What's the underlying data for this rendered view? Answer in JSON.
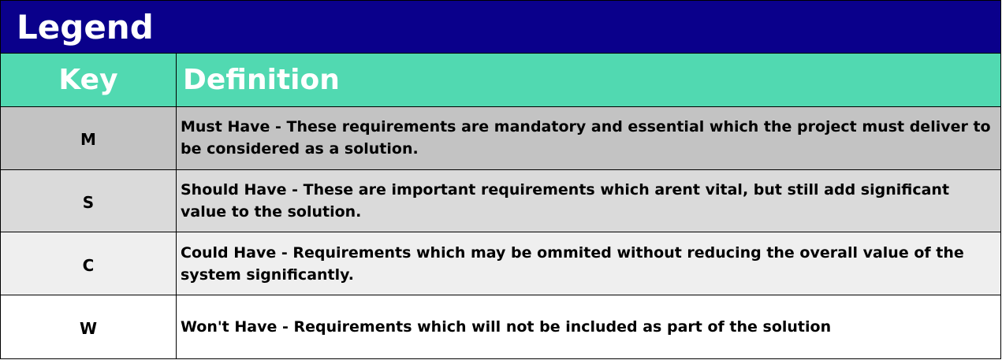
{
  "legend": {
    "title": "Legend",
    "header": {
      "key_label": "Key",
      "definition_label": "Definition",
      "background": "#51d9b1"
    },
    "title_background": "#0a008b",
    "rows": [
      {
        "key": "M",
        "definition": "Must Have - These requirements are mandatory and essential which the project must deliver to be considered as a solution.",
        "background": "#c3c3c3"
      },
      {
        "key": "S",
        "definition": "Should Have - These are important requirements which arent vital, but still add significant value to the solution.",
        "background": "#dadada"
      },
      {
        "key": "C",
        "definition": "Could Have - Requirements which may be ommited without reducing the overall value of the system significantly.",
        "background": "#efefef"
      },
      {
        "key": "W",
        "definition": "Won't Have - Requirements which will not be included as part of the solution",
        "background": "#ffffff"
      }
    ]
  }
}
